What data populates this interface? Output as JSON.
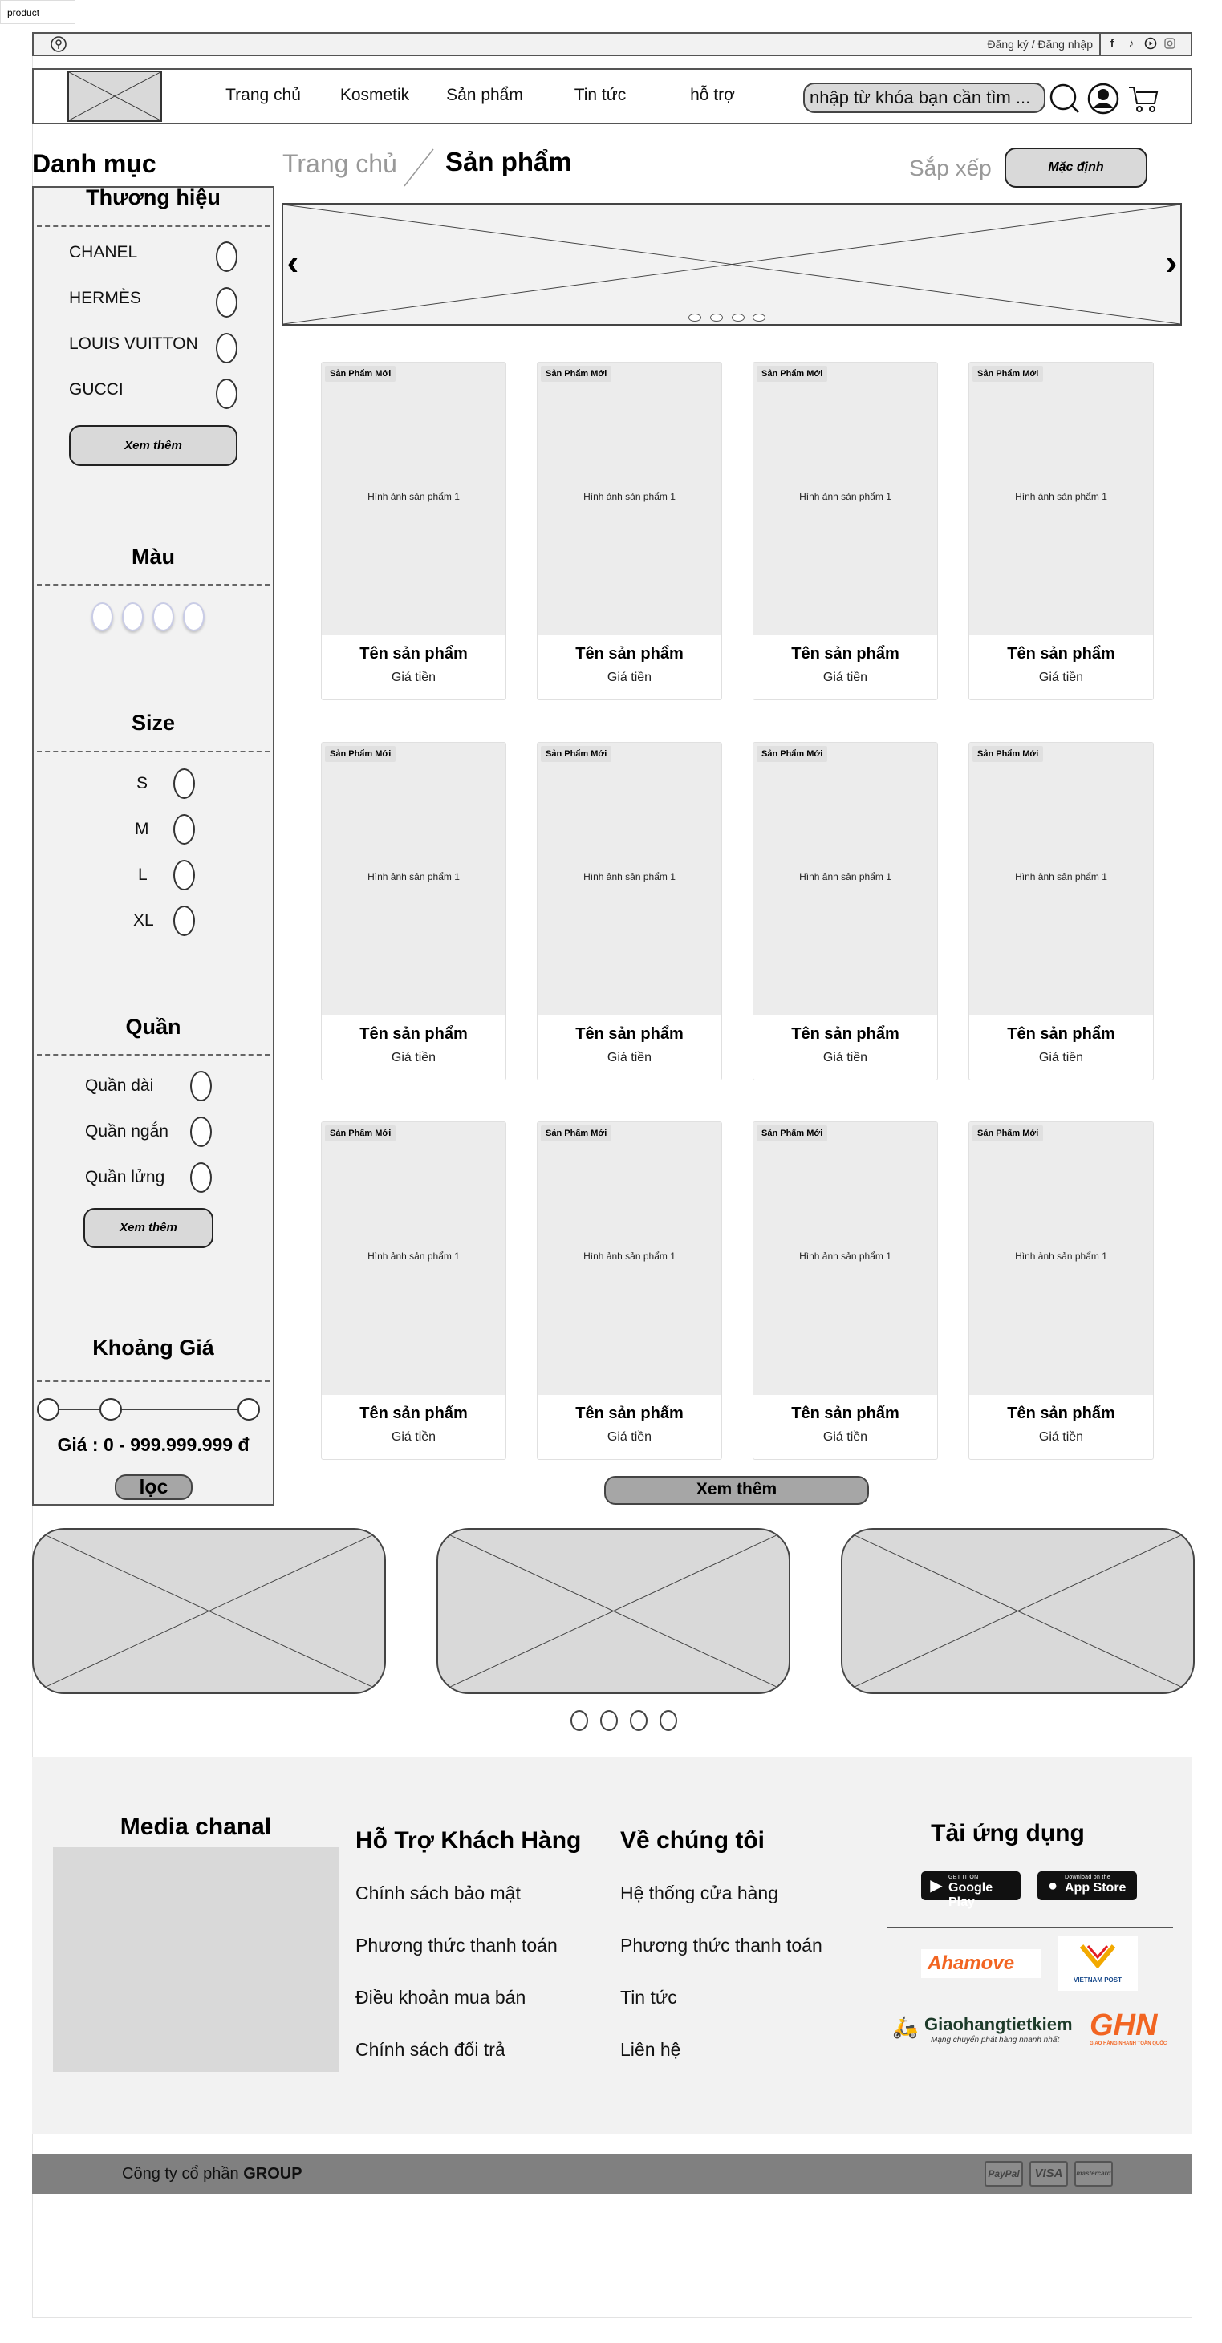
{
  "page_tab": "product",
  "utility": {
    "auth_text": "Đăng ký / Đăng nhập",
    "icons": [
      "location-icon",
      "facebook-icon",
      "tiktok-icon",
      "youtube-icon",
      "instagram-icon"
    ]
  },
  "header": {
    "nav": [
      "Trang chủ",
      "Kosmetik",
      "Sản phẩm",
      "Tin tức",
      "hỗ trợ"
    ],
    "search_placeholder": "nhập từ khóa bạn cần tìm ...",
    "icons": [
      "search-icon",
      "user-icon",
      "cart-icon"
    ]
  },
  "sidebar": {
    "title": "Danh mục",
    "brand": {
      "title": "Thương hiệu",
      "items": [
        "CHANEL",
        "HERMÈS",
        "LOUIS VUITTON",
        "GUCCI"
      ],
      "more": "Xem thêm"
    },
    "color": {
      "title": "Màu",
      "swatches": 4
    },
    "size": {
      "title": "Size",
      "items": [
        "S",
        "M",
        "L",
        "XL"
      ]
    },
    "pants": {
      "title": "Quần",
      "items": [
        "Quần dài",
        "Quần ngắn",
        "Quần lửng"
      ],
      "more": "Xem thêm"
    },
    "price": {
      "title": "Khoảng Giá",
      "text": "Giá : 0 - 999.999.999 đ",
      "filter_button": "lọc"
    }
  },
  "breadcrumb": {
    "home": "Trang chủ",
    "current": "Sản phẩm"
  },
  "sort": {
    "label": "Sắp xếp",
    "value": "Mặc định"
  },
  "banner": {
    "dots": 4
  },
  "products": {
    "rows": 3,
    "cols": 4,
    "card": {
      "badge": "Sản Phẩm Mới",
      "image_text": "Hình ảnh sản phẩm 1",
      "name": "Tên sản phẩm",
      "price": "Giá tiền"
    },
    "view_more": "Xem thêm"
  },
  "promo": {
    "count": 3,
    "dots": 4
  },
  "footer": {
    "media": {
      "title": "Media chanal"
    },
    "support": {
      "title": "Hỗ Trợ Khách Hàng",
      "links": [
        "Chính sách bảo mật",
        "Phương thức thanh toán",
        "Điều khoản mua bán",
        "Chính sách đổi trả"
      ]
    },
    "about": {
      "title": "Về chúng tôi",
      "links": [
        "Hệ thống cửa hàng",
        "Phương thức thanh toán",
        "Tin tức",
        "Liên hệ"
      ]
    },
    "app": {
      "title": "Tải ứng dụng",
      "google_small": "GET IT ON",
      "google_big": "Google Play",
      "apple_small": "Download on the",
      "apple_big": "App Store"
    },
    "shipping": {
      "ahamove": "Ahamove",
      "vnpost": "VIETNAM POST",
      "ghtk": "Giaohangtietkiem",
      "ghtk_tagline": "Mạng chuyển phát hàng nhanh nhất",
      "ghn": "GHN",
      "ghn_tagline": "GIAO HÀNG NHANH TOÀN QUỐC"
    }
  },
  "bottombar": {
    "company_prefix": "Công ty cổ phần ",
    "company_name": "GROUP",
    "payments": [
      "PayPal",
      "VISA",
      "mastercard"
    ]
  }
}
